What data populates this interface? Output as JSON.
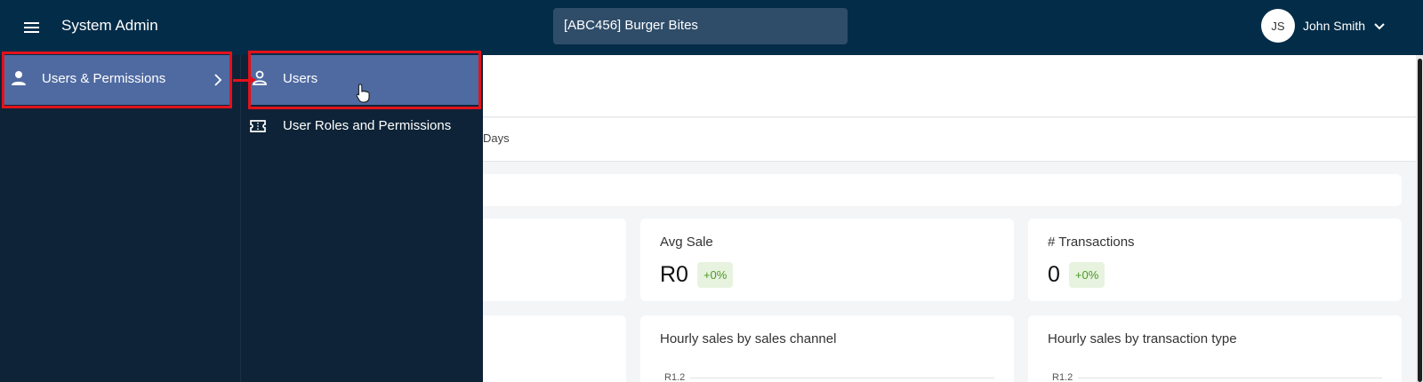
{
  "topbar": {
    "app_title": "System Admin",
    "store_select": "[ABC456] Burger Bites",
    "user": {
      "initials": "JS",
      "name": "John Smith"
    }
  },
  "icons": {
    "menu": "hamburger-icon",
    "user_chevron": "chevron-down-icon",
    "users_permissions": "person-filled-icon",
    "submenu_chevron": "chevron-right-icon",
    "users": "person-outline-icon",
    "roles": "ticket-icon",
    "cursor": "hand-pointer-icon"
  },
  "sidebar": {
    "items": [
      {
        "label": "Users & Permissions"
      }
    ]
  },
  "submenu": {
    "items": [
      {
        "label": "Users"
      },
      {
        "label": "User Roles and Permissions"
      }
    ]
  },
  "dashboard": {
    "tab_fragment": "Days",
    "cards": [
      {
        "title": "Avg Sale",
        "value": "R0",
        "change": "+0%"
      },
      {
        "title": "# Transactions",
        "value": "0",
        "change": "+0%"
      }
    ],
    "charts": [
      {
        "title": "Hourly sales by sales channel",
        "axis_tick": "R1.2"
      },
      {
        "title": "Hourly sales by transaction type",
        "axis_tick": "R1.2"
      }
    ]
  },
  "colors": {
    "topbar": "#032c48",
    "nav_bg": "#0e2337",
    "nav_active": "#4f6aa1",
    "annotation": "#e3121b",
    "badge_bg": "#e7f3df",
    "badge_text": "#4b9a26"
  }
}
